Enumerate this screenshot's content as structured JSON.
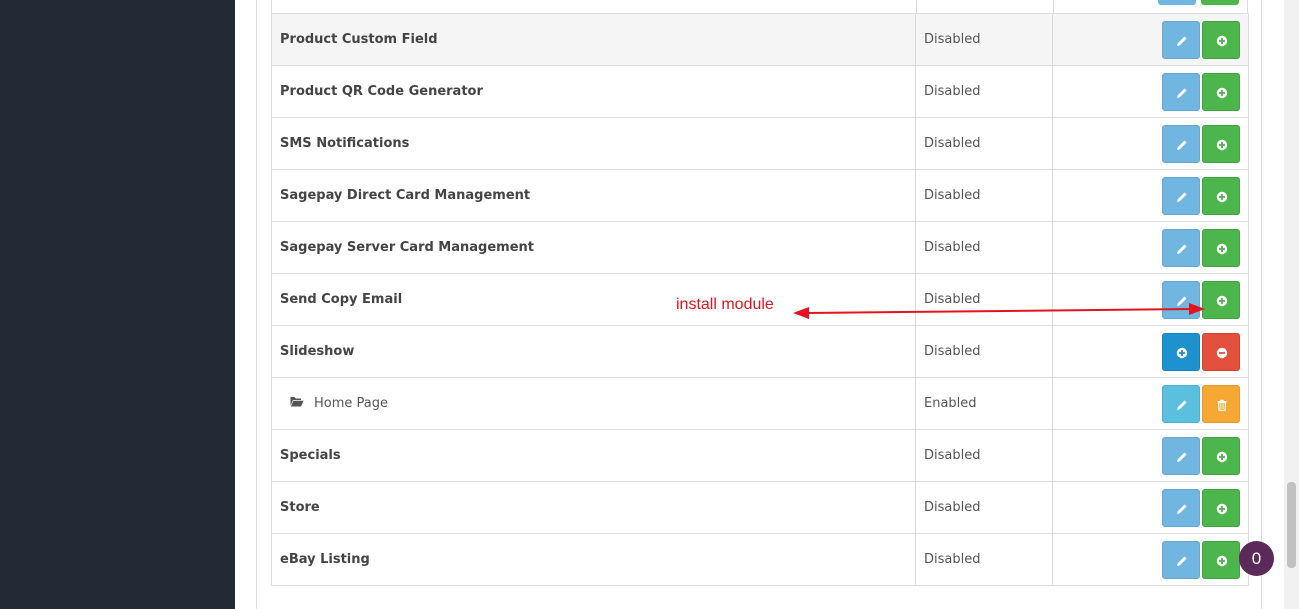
{
  "modules": [
    {
      "name": "Product Custom Field",
      "status": "Disabled",
      "installed": false
    },
    {
      "name": "Product QR Code Generator",
      "status": "Disabled",
      "installed": false
    },
    {
      "name": "SMS Notifications",
      "status": "Disabled",
      "installed": false
    },
    {
      "name": "Sagepay Direct Card Management",
      "status": "Disabled",
      "installed": false
    },
    {
      "name": "Sagepay Server Card Management",
      "status": "Disabled",
      "installed": false
    },
    {
      "name": "Send Copy Email",
      "status": "Disabled",
      "installed": false
    },
    {
      "name": "Slideshow",
      "status": "Disabled",
      "installed": true
    },
    {
      "name": "Home Page",
      "status": "Enabled",
      "installed": true,
      "child": true
    },
    {
      "name": "Specials",
      "status": "Disabled",
      "installed": false
    },
    {
      "name": "Store",
      "status": "Disabled",
      "installed": false
    },
    {
      "name": "eBay Listing",
      "status": "Disabled",
      "installed": false
    }
  ],
  "annotation": {
    "text": "install module",
    "color": "#e4141e"
  },
  "chat": {
    "count": "0"
  },
  "colors": {
    "edit": "#70b6e0",
    "install": "#4cb64c",
    "add": "#1e91cf",
    "uninstall": "#e3503e",
    "edit_sub": "#5bc0de",
    "delete": "#f6a834",
    "sidebar": "#232a36"
  },
  "icons": {
    "edit": "pencil-icon",
    "install": "plus-circle-icon",
    "add": "plus-circle-icon",
    "uninstall": "minus-circle-icon",
    "delete": "trash-icon",
    "folder": "folder-open-icon"
  }
}
